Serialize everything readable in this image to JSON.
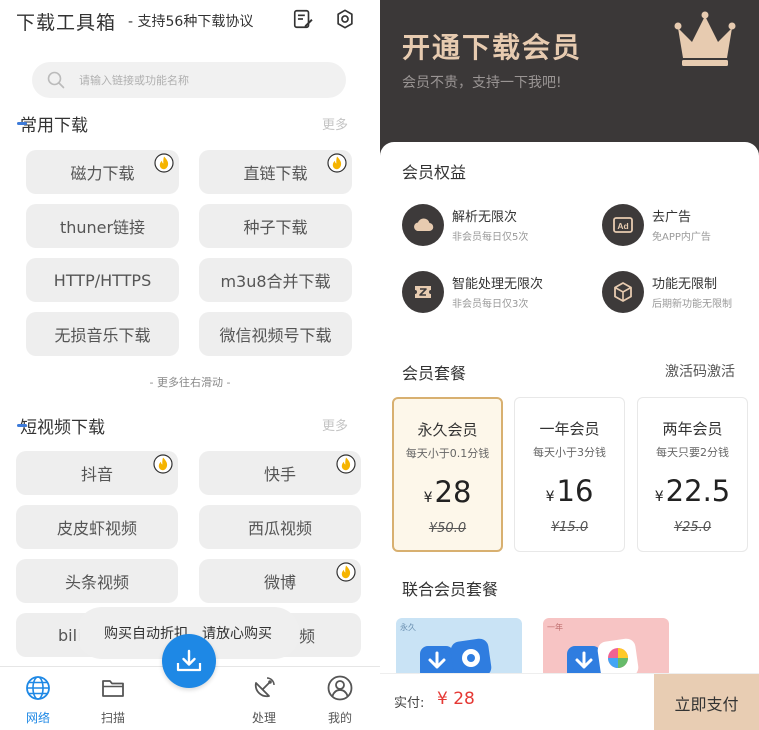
{
  "left": {
    "app_title": "下载工具箱",
    "app_subtitle": "- 支持56种下载协议",
    "search_placeholder": "请输入链接或功能名称",
    "common": {
      "title": "常用下载",
      "more": "更多",
      "items": [
        "磁力下载",
        "直链下载",
        "thuner链接",
        "种子下载",
        "HTTP/HTTPS",
        "m3u8合并下载",
        "无损音乐下载",
        "微信视频号下载"
      ]
    },
    "scroll_hint": "- 更多往右滑动 -",
    "short_video": {
      "title": "短视频下载",
      "more": "更多",
      "items": [
        "抖音",
        "快手",
        "皮皮虾视频",
        "西瓜视频",
        "头条视频",
        "微博",
        "bili",
        "频"
      ]
    },
    "toast": "购买自动折扣，请放心购买",
    "nav": [
      "网络",
      "扫描",
      "处理",
      "我的"
    ],
    "colors": {
      "accent": "#1e88e5",
      "hot": "#f5b400"
    }
  },
  "right": {
    "hero_title": "开通下载会员",
    "hero_subtitle": "会员不贵，支持一下我吧!",
    "benefits_title": "会员权益",
    "benefits": [
      {
        "title": "解析无限次",
        "sub": "非会员每日仅5次",
        "icon": "cloud-icon"
      },
      {
        "title": "去广告",
        "sub": "免APP内广告",
        "icon": "ad-icon"
      },
      {
        "title": "智能处理无限次",
        "sub": "非会员每日仅3次",
        "icon": "ticket-icon"
      },
      {
        "title": "功能无限制",
        "sub": "后期新功能无限制",
        "icon": "cube-icon"
      }
    ],
    "plans_title": "会员套餐",
    "activate": "激活码激活",
    "plans": [
      {
        "name": "永久会员",
        "desc": "每天小于0.1分钱",
        "currency": "¥",
        "price": "28",
        "original": "¥50.0"
      },
      {
        "name": "一年会员",
        "desc": "每天小于3分钱",
        "currency": "¥",
        "price": "16",
        "original": "¥15.0"
      },
      {
        "name": "两年会员",
        "desc": "每天只要2分钱",
        "currency": "¥",
        "price": "22.5",
        "original": "¥25.0"
      }
    ],
    "combo_title": "联合会员套餐",
    "combo_tags": [
      "永久",
      "一年"
    ],
    "pay_label": "实付:",
    "pay_amount": "¥ 28",
    "pay_button": "立即支付",
    "colors": {
      "gold": "#e7cbb0",
      "dark": "#3b3838",
      "price_red": "#e53935"
    }
  }
}
